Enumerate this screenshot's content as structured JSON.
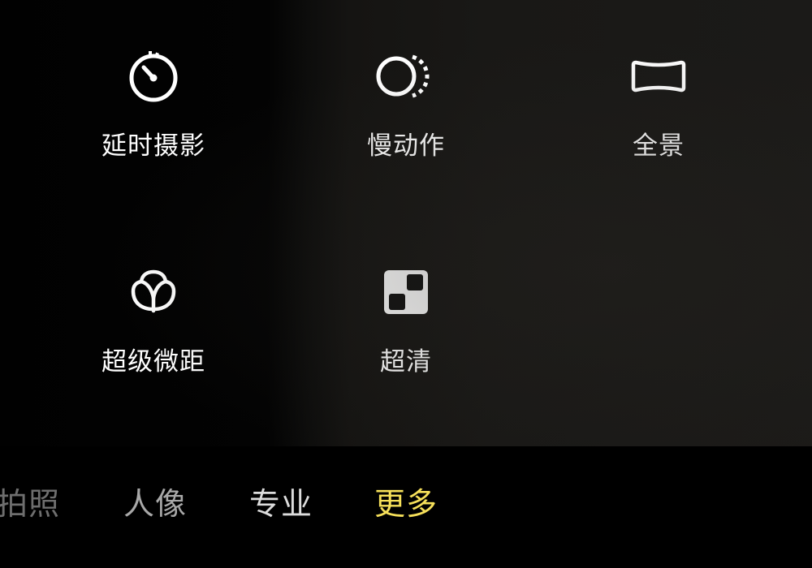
{
  "modes": [
    {
      "id": "timelapse",
      "label": "延时摄影",
      "icon": "stopwatch-icon"
    },
    {
      "id": "slowmo",
      "label": "慢动作",
      "icon": "slow-motion-icon"
    },
    {
      "id": "panorama",
      "label": "全景",
      "icon": "panorama-icon"
    },
    {
      "id": "macro",
      "label": "超级微距",
      "icon": "flower-icon"
    },
    {
      "id": "hd",
      "label": "超清",
      "icon": "high-res-icon"
    }
  ],
  "tabs": [
    {
      "id": "photo",
      "label": "拍照",
      "state": "inactive"
    },
    {
      "id": "portrait",
      "label": "人像",
      "state": "inactive"
    },
    {
      "id": "pro",
      "label": "专业",
      "state": "inactive"
    },
    {
      "id": "more",
      "label": "更多",
      "state": "active"
    }
  ],
  "colors": {
    "active_tab": "#f6e05a",
    "text": "#ffffff",
    "background": "#000000"
  }
}
